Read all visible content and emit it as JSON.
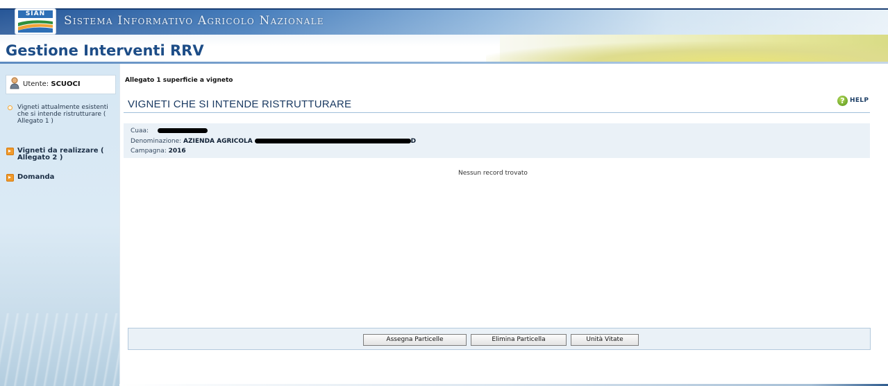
{
  "header": {
    "logo_text": "SIAN",
    "system_title": "Sistema Informativo Agricolo Nazionale",
    "app_title": "Gestione Interventi RRV"
  },
  "sidebar": {
    "user_label": "Utente:",
    "user_name": "SCUOCI",
    "items": [
      {
        "label": "Vigneti attualmente esistenti che si intende ristrutturare ( Allegato 1 )",
        "icon": "circle-bullet-icon",
        "active": true
      },
      {
        "label": "Vigneti da realizzare ( Allegato 2 )",
        "icon": "orange-arrow-icon",
        "active": false
      },
      {
        "label": "Domanda",
        "icon": "orange-arrow-icon",
        "active": false
      }
    ]
  },
  "main": {
    "breadcrumb": "Allegato 1 superficie a vigneto",
    "section_title": "VIGNETI CHE SI INTENDE RISTRUTTURARE",
    "help_label": "HELP",
    "info": {
      "cuaa_label": "Cuaa:",
      "denominazione_label": "Denominazione:",
      "denominazione_value": "AZIENDA AGRICOLA",
      "denominazione_suffix": "D",
      "campagna_label": "Campagna:",
      "campagna_value": "2016"
    },
    "empty_message": "Nessun record trovato",
    "buttons": {
      "assegna": "Assegna Particelle",
      "elimina": "Elimina Particella",
      "unita": "Unità Vitate"
    }
  },
  "colors": {
    "header_blue": "#1d4f93",
    "title_blue": "#1d4d87",
    "sidebar_bg": "#d6e7f4",
    "info_bg": "#eaf1f7",
    "menu_orange": "#f09a2c",
    "help_green": "#6ea72a"
  }
}
